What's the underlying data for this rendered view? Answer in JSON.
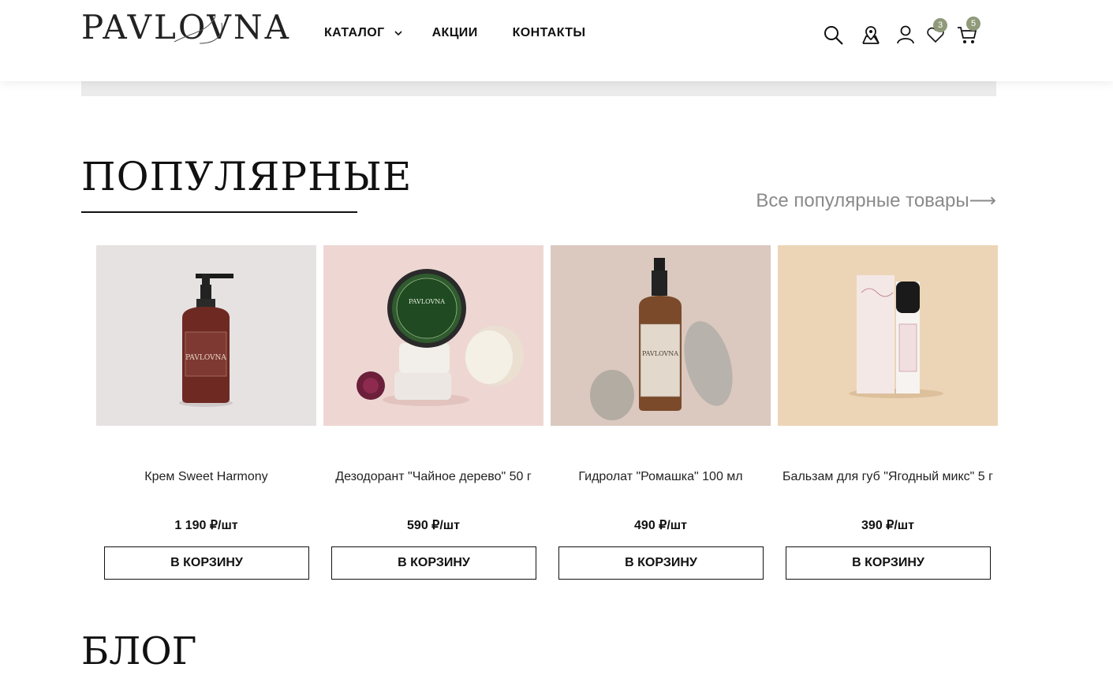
{
  "header": {
    "logo_text": "PAVLOVNA",
    "nav": [
      {
        "label": "КАТАЛОГ",
        "has_dropdown": true
      },
      {
        "label": "АКЦИИ"
      },
      {
        "label": "КОНТАКТЫ"
      }
    ],
    "icons": [
      "search-icon",
      "map-pin-icon",
      "user-icon",
      "heart-icon",
      "cart-icon"
    ],
    "favorites_count": "3",
    "cart_count": "5",
    "badge_color": "#8f9a7a"
  },
  "popular": {
    "title": "ПОПУЛЯРНЫЕ",
    "all_link": "Все популярные товары⟶"
  },
  "products": [
    {
      "name": "Крем Sweet Harmony",
      "price": "1 190 ₽/шт",
      "button": "В КОРЗИНУ",
      "bg": "#e6e2e2"
    },
    {
      "name": "Дезодорант \"Чайное дерево\" 50 г",
      "price": "590 ₽/шт",
      "button": "В КОРЗИНУ",
      "bg": "#eed7d3"
    },
    {
      "name": "Гидролат \"Ромашка\" 100 мл",
      "price": "490 ₽/шт",
      "button": "В КОРЗИНУ",
      "bg": "#dbc8bf"
    },
    {
      "name": "Бальзам для губ \"Ягодный микс\" 5 г",
      "price": "390 ₽/шт",
      "button": "В КОРЗИНУ",
      "bg": "#ecd5b6"
    }
  ],
  "blog": {
    "title": "БЛОГ"
  }
}
